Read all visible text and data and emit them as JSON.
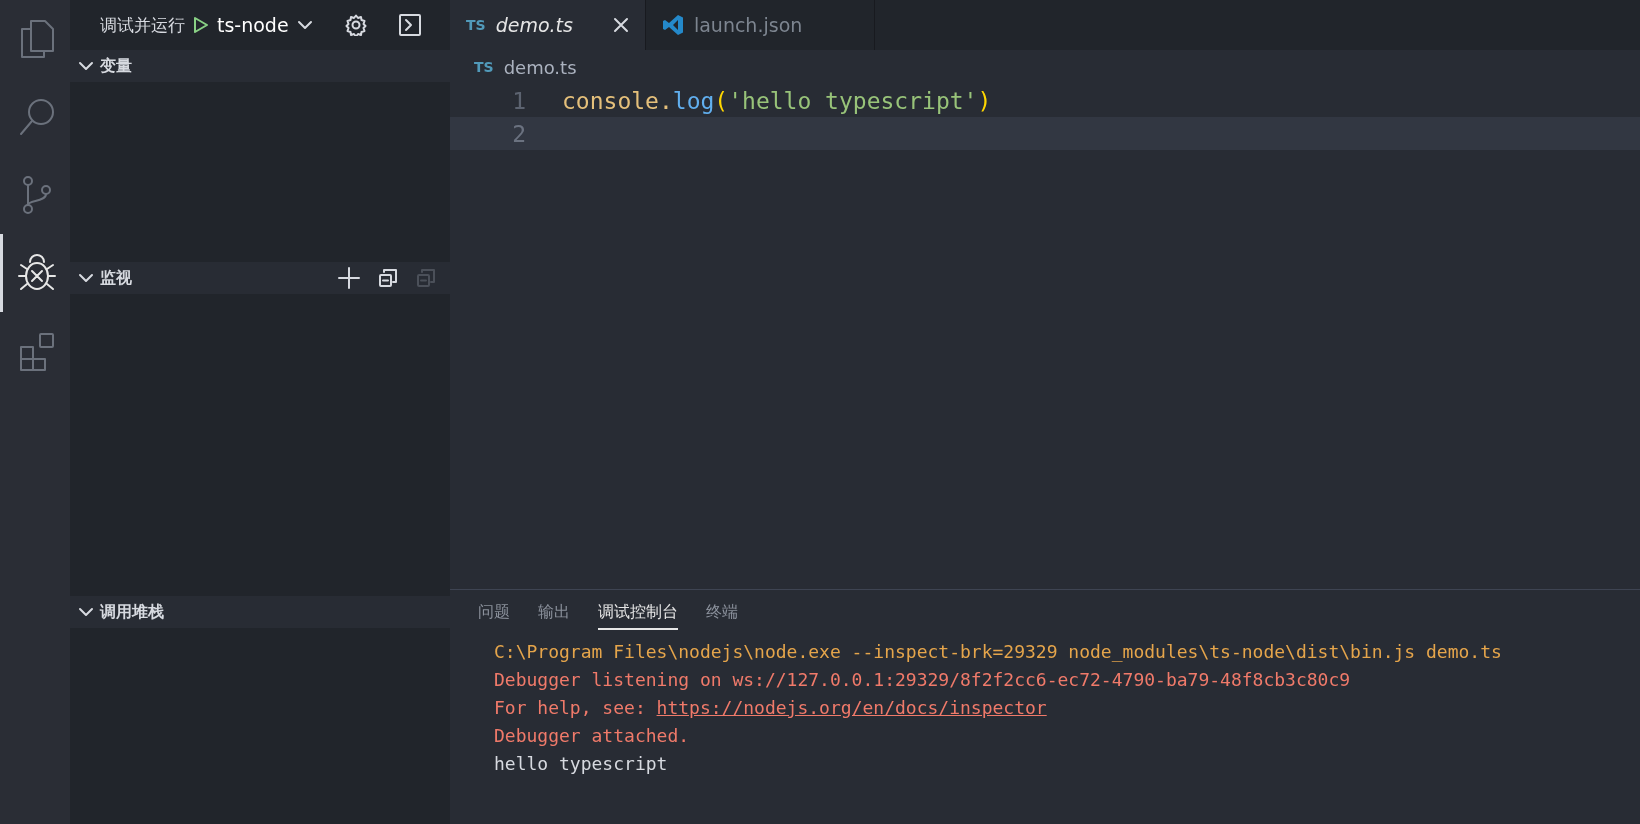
{
  "activity_bar": {
    "items": [
      {
        "kind": "explorer",
        "selected": false
      },
      {
        "kind": "search",
        "selected": false
      },
      {
        "kind": "source-control",
        "selected": false
      },
      {
        "kind": "debug",
        "selected": true
      },
      {
        "kind": "extensions",
        "selected": false
      }
    ]
  },
  "sidebar": {
    "title": "调试并运行",
    "configuration": "ts-node",
    "sections": [
      {
        "title": "变量",
        "expanded": true
      },
      {
        "title": "监视",
        "expanded": true,
        "actions": [
          {
            "kind": "add",
            "disabled": false
          },
          {
            "kind": "collapse",
            "disabled": false
          },
          {
            "kind": "collapse",
            "disabled": true
          }
        ]
      },
      {
        "title": "调用堆栈",
        "expanded": true
      }
    ]
  },
  "editor": {
    "tabs": [
      {
        "label": "demo.ts",
        "kind": "typescript",
        "icon_text": "TS",
        "selected": true,
        "preview": true
      },
      {
        "label": "launch.json",
        "kind": "config",
        "selected": false,
        "preview": false
      }
    ],
    "breadcrumb": {
      "icon_text": "TS",
      "label": "demo.ts"
    },
    "lines": [
      {
        "number": "1",
        "current": false,
        "tokens": [
          {
            "kind": "variable",
            "text": "console."
          },
          {
            "kind": "function",
            "text": "log"
          },
          {
            "kind": "bracket",
            "text": "("
          },
          {
            "kind": "string",
            "text": "'hello typescript'"
          },
          {
            "kind": "bracket",
            "text": ")"
          }
        ]
      },
      {
        "number": "2",
        "current": true
      }
    ]
  },
  "panel": {
    "tabs": [
      {
        "label": "问题",
        "selected": false
      },
      {
        "label": "输出",
        "selected": false
      },
      {
        "label": "调试控制台",
        "selected": true
      },
      {
        "label": "终端",
        "selected": false
      }
    ],
    "output": [
      {
        "kind": "command",
        "text": "C:\\Program Files\\nodejs\\node.exe --inspect-brk=29329 node_modules\\ts-node\\dist\\bin.js demo.ts"
      },
      {
        "kind": "error",
        "text": "Debugger listening on ws://127.0.0.1:29329/8f2f2cc6-ec72-4790-ba79-48f8cb3c80c9"
      },
      {
        "kind": "error",
        "text": "For help, see: ",
        "link": "https://nodejs.org/en/docs/inspector"
      },
      {
        "kind": "error",
        "text": "Debugger attached."
      },
      {
        "kind": "plain",
        "text": "hello typescript"
      }
    ]
  }
}
